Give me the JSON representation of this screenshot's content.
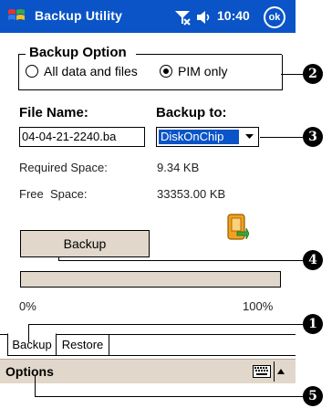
{
  "titlebar": {
    "app_title": "Backup Utility",
    "time": "10:40",
    "ok_label": "ok",
    "color": "#0a54c7",
    "icons": [
      "windows-logo-icon",
      "connectivity-icon",
      "volume-icon",
      "ok-icon"
    ]
  },
  "backup_option": {
    "title": "Backup Option",
    "options": [
      {
        "label": "All data and files",
        "selected": false
      },
      {
        "label": "PIM only",
        "selected": true
      }
    ]
  },
  "file": {
    "name_label": "File Name:",
    "name_value": "04-04-21-2240.ba",
    "backup_to_label": "Backup to:",
    "backup_to_value": "DiskOnChip"
  },
  "space": {
    "required_label": "Required Space:",
    "required_value": "9.34 KB",
    "free_label": "Free  Space:",
    "free_value": "33353.00 KB"
  },
  "actions": {
    "backup_label": "Backup"
  },
  "progress": {
    "value": 0,
    "min_label": "0%",
    "max_label": "100%"
  },
  "tabs": [
    {
      "label": "Backup",
      "active": true
    },
    {
      "label": "Restore",
      "active": false
    }
  ],
  "menubar": {
    "options_label": "Options",
    "icons": [
      "keyboard-icon",
      "up-arrow-icon"
    ]
  },
  "callouts": [
    "1",
    "2",
    "3",
    "4",
    "5"
  ]
}
